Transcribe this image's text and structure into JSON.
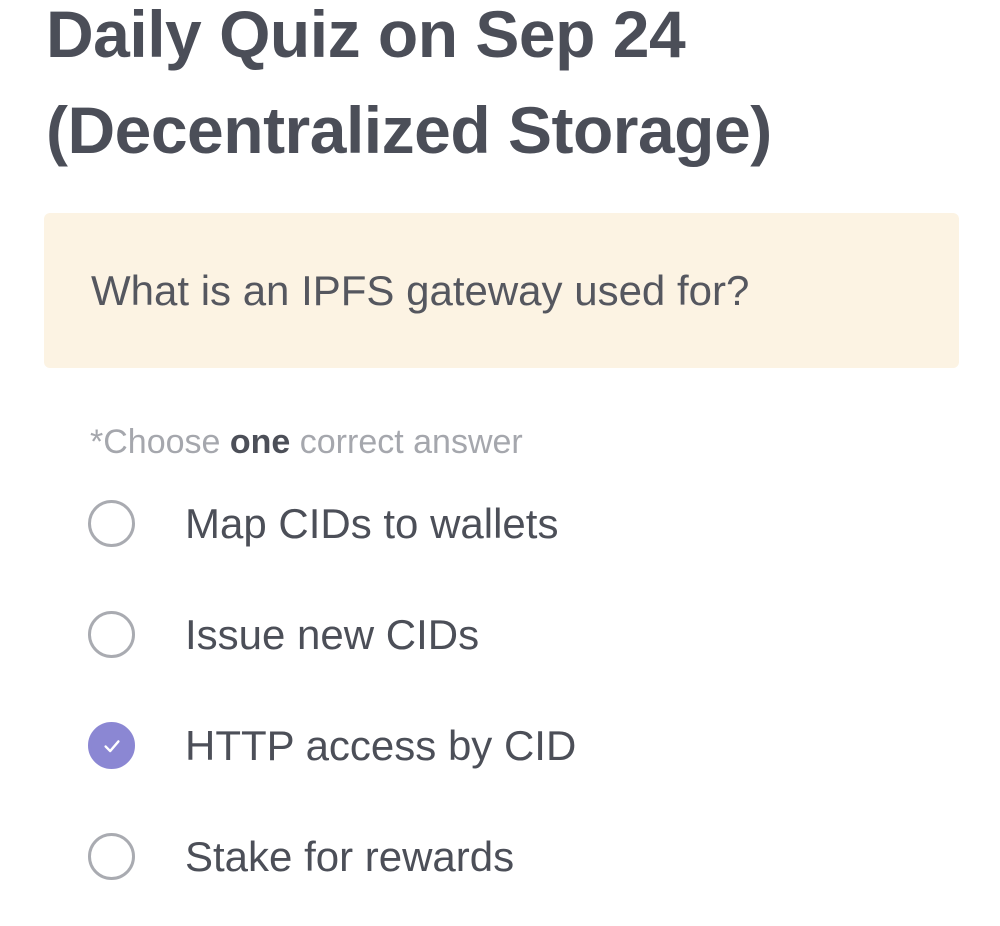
{
  "quiz": {
    "title_line1": "Daily Quiz on Sep 24",
    "title_line2": "(Decentralized Storage)",
    "question": "What is an IPFS gateway used for?",
    "instruction": {
      "prefix": "*Choose ",
      "emphasis": "one",
      "suffix": " correct answer"
    },
    "options": [
      {
        "label": "Map CIDs to wallets",
        "selected": false
      },
      {
        "label": "Issue new CIDs",
        "selected": false
      },
      {
        "label": "HTTP access by CID",
        "selected": true
      },
      {
        "label": "Stake for rewards",
        "selected": false
      }
    ],
    "colors": {
      "accent": "#8b87d3",
      "question_background": "#fcf3e3",
      "title_text": "#4b4e58",
      "muted_text": "#a5a7ad"
    }
  }
}
